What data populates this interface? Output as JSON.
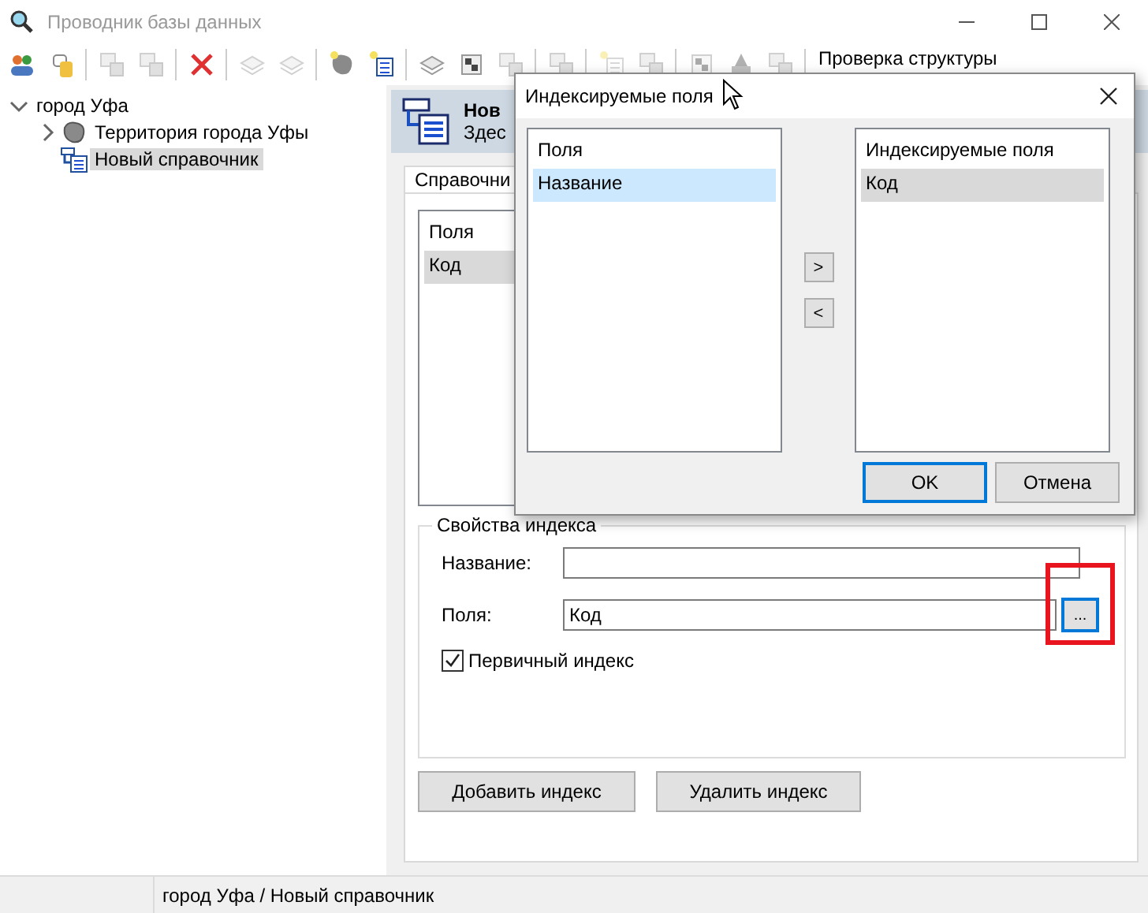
{
  "window": {
    "title": "Проводник базы данных",
    "active": false
  },
  "toolbar": {
    "items": [
      {
        "kind": "people",
        "disabled": false
      },
      {
        "kind": "database",
        "disabled": false
      },
      {
        "kind": "separator"
      },
      {
        "kind": "copy",
        "disabled": true
      },
      {
        "kind": "copy",
        "disabled": true
      },
      {
        "kind": "separator"
      },
      {
        "kind": "delete",
        "disabled": false
      },
      {
        "kind": "separator"
      },
      {
        "kind": "layers",
        "disabled": true
      },
      {
        "kind": "layers",
        "disabled": true
      },
      {
        "kind": "separator"
      },
      {
        "kind": "region",
        "disabled": false
      },
      {
        "kind": "table",
        "disabled": false
      },
      {
        "kind": "separator"
      },
      {
        "kind": "layers",
        "disabled": false
      },
      {
        "kind": "checker",
        "disabled": false
      },
      {
        "kind": "copy",
        "disabled": true
      },
      {
        "kind": "separator"
      },
      {
        "kind": "copy",
        "disabled": true
      },
      {
        "kind": "separator"
      },
      {
        "kind": "table",
        "disabled": true
      },
      {
        "kind": "copy",
        "disabled": true
      },
      {
        "kind": "separator"
      },
      {
        "kind": "checker",
        "disabled": true
      },
      {
        "kind": "pin",
        "disabled": true
      },
      {
        "kind": "copy",
        "disabled": true
      },
      {
        "kind": "separator"
      }
    ],
    "label": "Проверка структуры"
  },
  "tree": [
    {
      "label": "город Уфа",
      "expanded": true,
      "selected": false,
      "children": [
        {
          "label": "Территория города Уфы",
          "kind": "region",
          "expanded": false,
          "selected": false
        },
        {
          "label": "Новый справочник",
          "kind": "table",
          "selected": true
        }
      ]
    }
  ],
  "header": {
    "title": "Нов",
    "subtitle": "Здес"
  },
  "tabs": [
    {
      "label": "Справочни",
      "selected": true
    }
  ],
  "fields_list": {
    "header": "Поля",
    "focused": false,
    "items": [
      {
        "label": "Код",
        "selected": true
      }
    ]
  },
  "index_properties": {
    "title": "Свойства индекса",
    "name_label": "Название:",
    "fields_label": "Поля:",
    "fields_value": "Код",
    "browse_button": "...",
    "primary": {
      "label": "Первичный индекс",
      "checked": true
    }
  },
  "buttons": [
    "Добавить индекс",
    "Удалить индекс"
  ],
  "status_bar": "город Уфа / Новый справочник",
  "dialog": {
    "title": "Индексируемые поля",
    "left_list": {
      "header": "Поля",
      "focused": true,
      "items": [
        {
          "label": "Название",
          "selected": true
        }
      ]
    },
    "move_buttons": [
      ">",
      "<"
    ],
    "right_list": {
      "header": "Индексируемые поля",
      "focused": false,
      "items": [
        {
          "label": "Код",
          "selected": true
        }
      ]
    },
    "ok": "OK",
    "cancel": "Отмена"
  }
}
